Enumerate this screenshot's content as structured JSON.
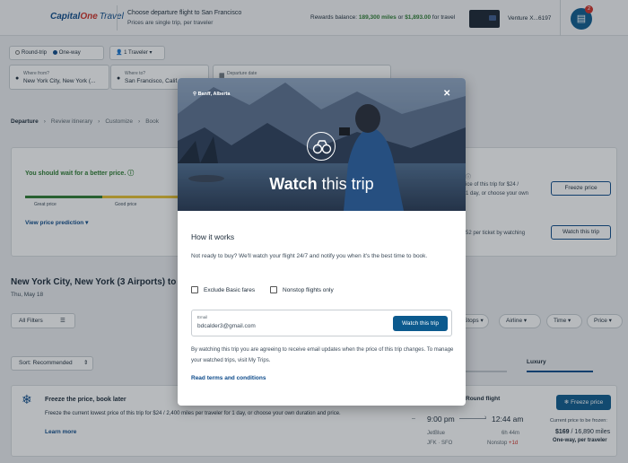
{
  "header": {
    "logo_main": "Capital",
    "logo_one": "One",
    "logo_travel": "Travel",
    "title": "Choose departure flight to San Francisco",
    "subtitle": "Prices are single trip, per traveler",
    "rewards_prefix": "Rewards balance:",
    "rewards_miles": "189,300 miles",
    "rewards_or": "or",
    "rewards_dollars": "$1,893.00",
    "rewards_suffix": "for travel",
    "card_name": "Venture X...6197",
    "trips_badge": "2"
  },
  "search": {
    "trip_types": [
      "Round-trip",
      "One-way"
    ],
    "selected_trip_type": "One-way",
    "travelers": "1 Traveler",
    "from_label": "Where from?",
    "from_value": "New York City, New York (...",
    "to_label": "Where to?",
    "to_value": "San Francisco, Calif...",
    "date_label": "Departure date"
  },
  "breadcrumb": [
    "Departure",
    "Review itinerary",
    "Customize",
    "Book"
  ],
  "price_prediction": {
    "headline": "You should wait for a better price.",
    "labels": [
      "Great price",
      "Good price"
    ],
    "view_link": "View price prediction",
    "freeze_text_1": "ice of this trip for $24 /",
    "freeze_text_2": "1 day, or choose your own",
    "freeze_button": "Freeze price",
    "watch_text": "52 per ticket by watching",
    "watch_button": "Watch this trip"
  },
  "results": {
    "route_title": "New York City, New York (3 Airports) to Sa",
    "date": "Thu, May 18",
    "all_filters": "All Filters",
    "filter_pills": [
      "Stops",
      "Airline",
      "Time",
      "Price"
    ],
    "sort": "Sort: Recommended",
    "fare_tab": "Luxury"
  },
  "freeze_card": {
    "title": "Freeze the price, book later",
    "description": "Freeze the current lowest price of this trip for $24 / 2,400 miles per traveler for 1 day, or choose your own duration and price.",
    "learn_more": "Learn more",
    "round_flight": "Round flight",
    "depart_time": "9:00 pm",
    "arrive_time": "12:44 am",
    "airline": "JetBlue",
    "duration": "6h 44m",
    "route": "JFK · SFO",
    "stops": "Nonstop",
    "day_offset": "+1d",
    "freeze_button": "Freeze price",
    "current_price_label": "Current price to be frozen:",
    "price": "$169",
    "price_miles": "/ 16,890 miles",
    "per_traveler": "One-way, per traveler"
  },
  "modal": {
    "location": "Banff, Alberta",
    "title_bold": "Watch",
    "title_rest": "this trip",
    "how_heading": "How it works",
    "how_desc": "Not ready to buy? We'll watch your flight 24/7 and notify you when it's the best time to book.",
    "exclude_basic": "Exclude Basic fares",
    "nonstop_only": "Nonstop flights only",
    "email_label": "Email",
    "email_value": "bdcalder3@gmail.com",
    "watch_button": "Watch this trip",
    "agreement": "By watching this trip you are agreeing to receive email updates when the price of this trip changes. To manage your watched trips, visit My Trips.",
    "terms_link": "Read terms and conditions"
  },
  "colors": {
    "brand_blue": "#0c4a8a",
    "button_blue": "#0c5a8e",
    "brand_red": "#d03027",
    "good_green": "#2d7d31"
  }
}
